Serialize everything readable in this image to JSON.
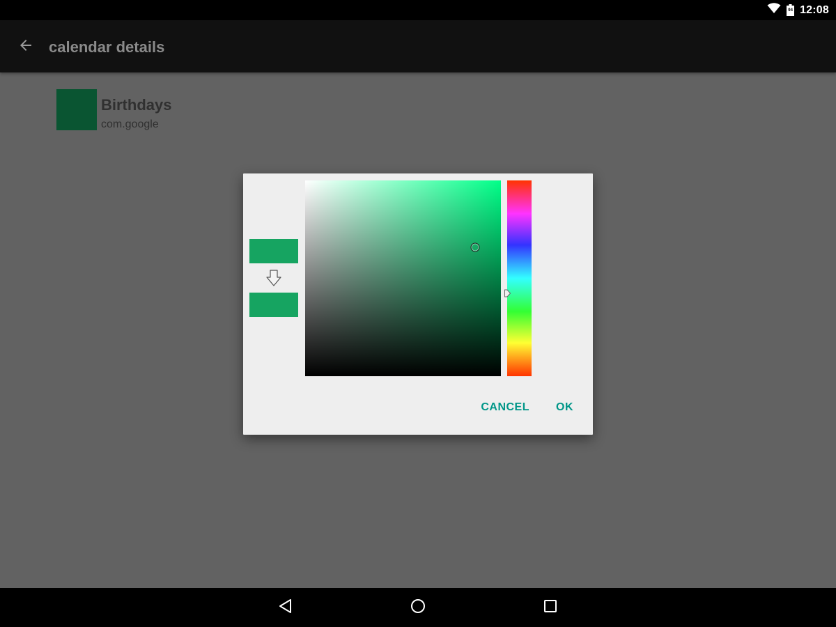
{
  "status_bar": {
    "time": "12:08",
    "battery_level": "94",
    "icons": [
      "wifi-icon",
      "battery-icon"
    ]
  },
  "app_bar": {
    "title": "calendar details",
    "back_icon": "arrow-back-icon"
  },
  "calendar": {
    "name": "Birthdays",
    "account": "com.google",
    "color": "#0a5532"
  },
  "color_picker": {
    "old_color": "#16a461",
    "new_color": "#16a461",
    "hue_base_color": "#00ff88",
    "saturation": 0.87,
    "value": 0.66,
    "hue_fraction": 0.57,
    "cancel_label": "CANCEL",
    "ok_label": "OK",
    "accent_color": "#009688"
  },
  "nav_bar": {
    "icons": [
      "back-triangle-icon",
      "home-circle-icon",
      "recents-square-icon"
    ]
  }
}
